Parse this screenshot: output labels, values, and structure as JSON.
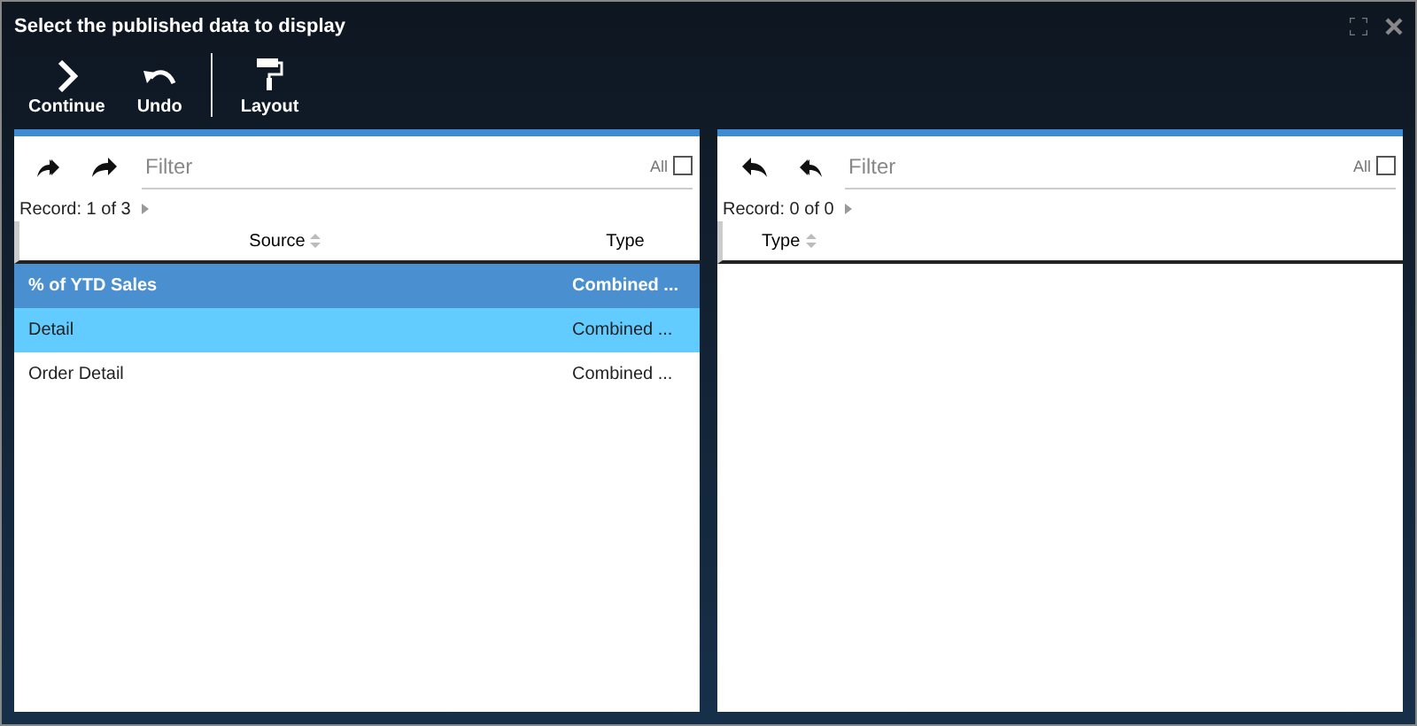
{
  "window": {
    "title": "Select the published data to display"
  },
  "toolbar": [
    {
      "kind": "continue",
      "label": "Continue"
    },
    {
      "kind": "undo",
      "label": "Undo"
    },
    {
      "kind": "divider"
    },
    {
      "kind": "layout",
      "label": "Layout"
    }
  ],
  "panels": [
    {
      "actions": [
        {
          "kind": "move-all"
        },
        {
          "kind": "move"
        }
      ],
      "filter": {
        "placeholder": "Filter"
      },
      "all_label": "All",
      "all_checked": false,
      "record": "Record: 1 of 3",
      "columns": [
        {
          "label": "Source",
          "sortable": true
        },
        {
          "label": "Type",
          "sortable": false
        }
      ],
      "rows": [
        {
          "cells": [
            "% of YTD Sales",
            "Combined ..."
          ],
          "selected": true,
          "highlighted": false
        },
        {
          "cells": [
            "Detail",
            "Combined ..."
          ],
          "selected": false,
          "highlighted": true
        },
        {
          "cells": [
            "Order Detail",
            "Combined ..."
          ],
          "selected": false,
          "highlighted": false
        }
      ]
    },
    {
      "actions": [
        {
          "kind": "back"
        },
        {
          "kind": "back-all"
        }
      ],
      "filter": {
        "placeholder": "Filter"
      },
      "all_label": "All",
      "all_checked": false,
      "record": "Record: 0 of 0",
      "columns": [
        {
          "label": "Type",
          "sortable": true
        }
      ]
    }
  ]
}
